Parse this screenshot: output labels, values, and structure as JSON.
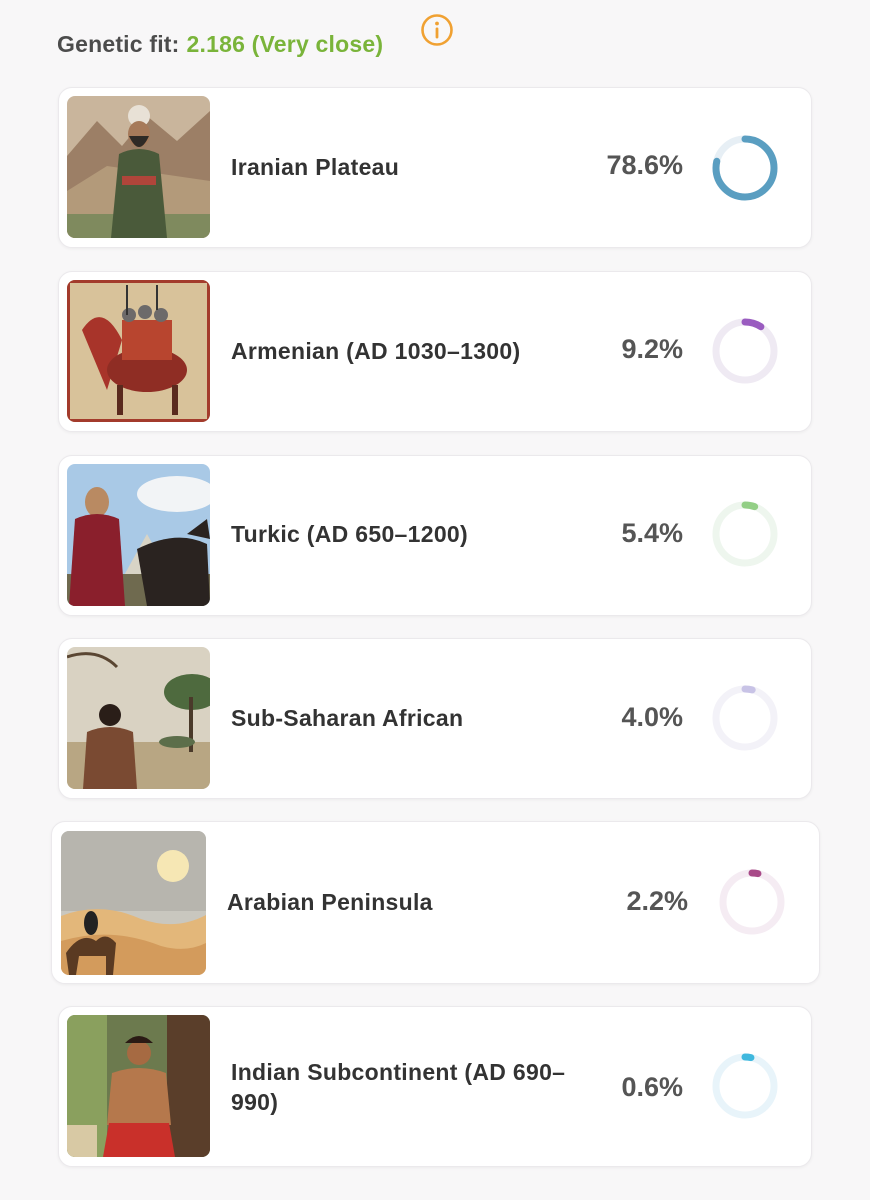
{
  "header": {
    "label": "Genetic fit:",
    "value": "2.186 (Very close)",
    "info_icon": "info-circle-icon",
    "value_color": "#7ab43a",
    "info_color": "#f0a132"
  },
  "populations": [
    {
      "name": "Iranian Plateau",
      "percent_label": "78.6%",
      "percent": 78.6,
      "color": "#5a9ec1",
      "track": "#e7eff5",
      "image": "bearded-man-in-turban-desert-painting"
    },
    {
      "name": "Armenian (AD 1030–1300)",
      "percent_label": "9.2%",
      "percent": 9.2,
      "color": "#9a5cc0",
      "track": "#efeaf3",
      "image": "medieval-horsemen-manuscript-painting"
    },
    {
      "name": "Turkic (AD 650–1200)",
      "percent_label": "5.4%",
      "percent": 5.4,
      "color": "#93cf86",
      "track": "#eef6ee",
      "image": "horseman-in-red-robe-painting"
    },
    {
      "name": "Sub-Saharan African",
      "percent_label": "4.0%",
      "percent": 4.0,
      "color": "#c8c3e6",
      "track": "#f3f2f8",
      "image": "man-in-savanna-painting"
    },
    {
      "name": "Arabian Peninsula",
      "percent_label": "2.2%",
      "percent": 2.2,
      "color": "#a84a88",
      "track": "#f5ecf3",
      "image": "camel-rider-in-desert-painting"
    },
    {
      "name": "Indian Subcontinent (AD 690–990)",
      "percent_label": "0.6%",
      "percent": 0.6,
      "color": "#3fb8de",
      "track": "#e8f4fa",
      "image": "man-in-traditional-dress-painting"
    }
  ]
}
